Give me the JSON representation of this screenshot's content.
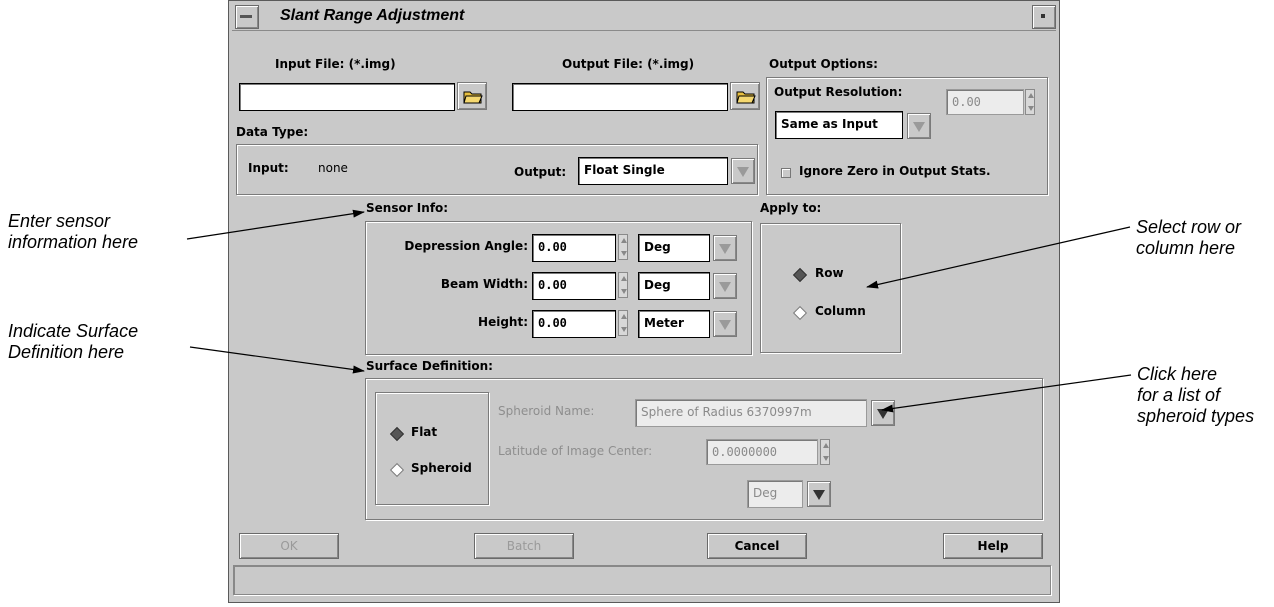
{
  "window": {
    "title": "Slant Range Adjustment"
  },
  "input_file": {
    "label": "Input File: (*.img)",
    "value": ""
  },
  "output_file": {
    "label": "Output File: (*.img)",
    "value": ""
  },
  "output_options": {
    "label": "Output Options:",
    "resolution_label": "Output Resolution:",
    "resolution_mode": "Same as Input",
    "resolution_value": "0.00",
    "ignore_zero_label": "Ignore Zero in Output Stats.",
    "ignore_zero_checked": false
  },
  "data_type": {
    "label": "Data Type:",
    "input_label": "Input:",
    "input_value": "none",
    "output_label": "Output:",
    "output_value": "Float Single"
  },
  "sensor_info": {
    "label": "Sensor Info:",
    "rows": [
      {
        "label": "Depression Angle:",
        "value": "0.00",
        "unit": "Deg"
      },
      {
        "label": "Beam Width:",
        "value": "0.00",
        "unit": "Deg"
      },
      {
        "label": "Height:",
        "value": "0.00",
        "unit": "Meter"
      }
    ]
  },
  "apply_to": {
    "label": "Apply to:",
    "options": [
      "Row",
      "Column"
    ],
    "selected": "Row"
  },
  "surface_definition": {
    "label": "Surface Definition:",
    "options": [
      "Flat",
      "Spheroid"
    ],
    "selected": "Flat",
    "spheroid_name_label": "Spheroid Name:",
    "spheroid_name_value": "Sphere of Radius 6370997m",
    "latitude_label": "Latitude of Image Center:",
    "latitude_value": "0.0000000",
    "latitude_unit": "Deg"
  },
  "buttons": {
    "ok": "OK",
    "batch": "Batch",
    "cancel": "Cancel",
    "help": "Help"
  },
  "callouts": {
    "sensor": [
      "Enter sensor",
      "information here"
    ],
    "surface": [
      "Indicate Surface",
      "Definition here"
    ],
    "rowcol": [
      "Select row or",
      "column here"
    ],
    "spheroid": [
      "Click here",
      "for a list of",
      "spheroid types"
    ]
  }
}
